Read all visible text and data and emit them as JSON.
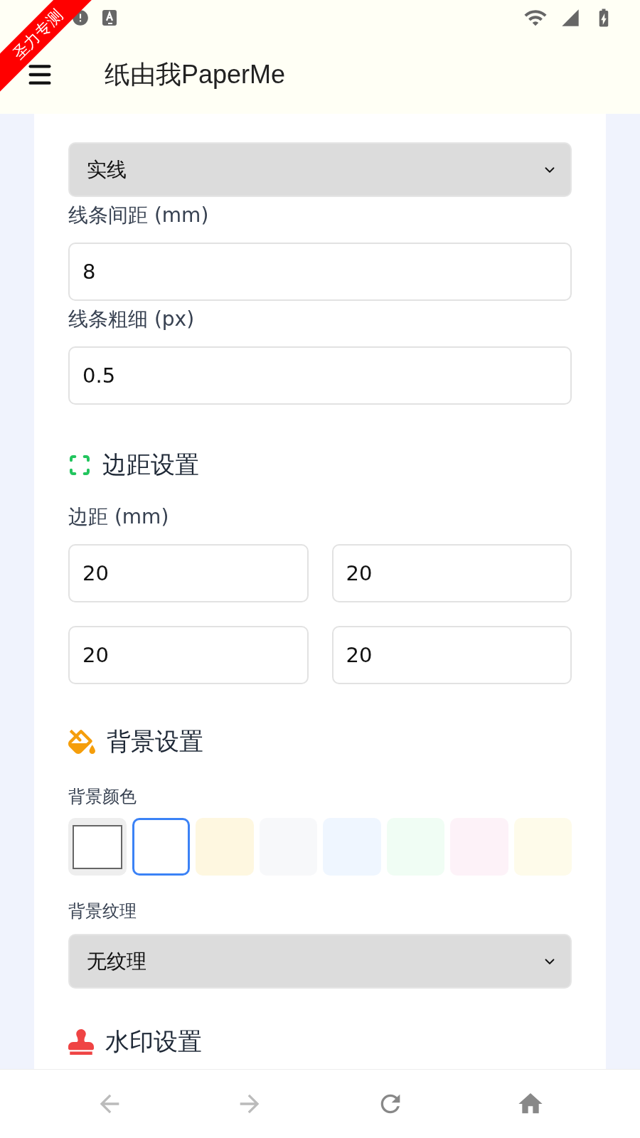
{
  "ribbon": {
    "text": "圣力专测"
  },
  "app_bar": {
    "title": "纸由我PaperMe"
  },
  "line_settings": {
    "style_value": "实线",
    "spacing_label": "线条间距 (mm)",
    "spacing_value": "8",
    "width_label": "线条粗细 (px)",
    "width_value": "0.5"
  },
  "margin_section": {
    "title": "边距设置",
    "label": "边距 (mm)",
    "values": [
      "20",
      "20",
      "20",
      "20"
    ]
  },
  "background_section": {
    "title": "背景设置",
    "color_label": "背景颜色",
    "swatches": [
      {
        "kind": "custom",
        "color": "#ffffff",
        "selected": false
      },
      {
        "kind": "plain",
        "color": "#ffffff",
        "selected": true
      },
      {
        "kind": "plain",
        "color": "#fef7e0",
        "selected": false
      },
      {
        "kind": "plain",
        "color": "#f7f8fa",
        "selected": false
      },
      {
        "kind": "plain",
        "color": "#eff6ff",
        "selected": false
      },
      {
        "kind": "plain",
        "color": "#f0fdf4",
        "selected": false
      },
      {
        "kind": "plain",
        "color": "#fdf2f8",
        "selected": false
      },
      {
        "kind": "plain",
        "color": "#fefbea",
        "selected": false
      }
    ],
    "texture_label": "背景纹理",
    "texture_value": "无纹理"
  },
  "watermark_section": {
    "title": "水印设置"
  },
  "bottom_nav": [
    {
      "kind": "back",
      "disabled": true
    },
    {
      "kind": "forward",
      "disabled": true
    },
    {
      "kind": "reload",
      "disabled": false
    },
    {
      "kind": "home",
      "disabled": false
    }
  ]
}
